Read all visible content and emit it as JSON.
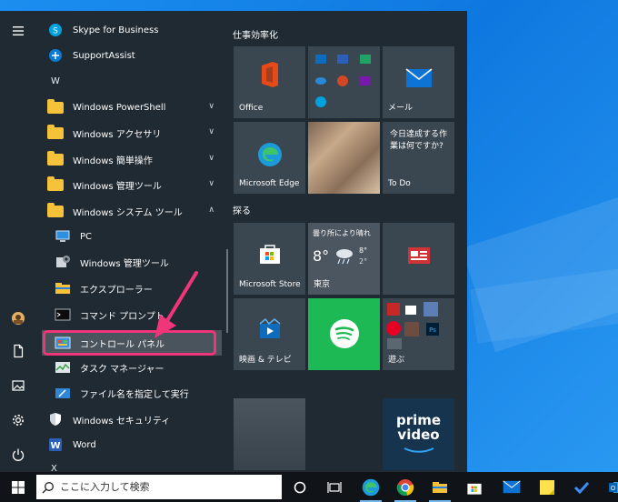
{
  "rail": {
    "menu_icon": "hamburger-icon",
    "bottom_icons": [
      "user-avatar",
      "documents-icon",
      "pictures-icon",
      "settings-icon",
      "power-icon"
    ]
  },
  "app_list": {
    "items": [
      {
        "label": "Skype for Business"
      },
      {
        "label": "SupportAssist"
      },
      {
        "letter": "W"
      },
      {
        "label": "Windows PowerShell"
      },
      {
        "label": "Windows アクセサリ"
      },
      {
        "label": "Windows 簡単操作"
      },
      {
        "label": "Windows 管理ツール"
      },
      {
        "label": "Windows システム ツール"
      },
      {
        "label": "PC"
      },
      {
        "label": "Windows 管理ツール"
      },
      {
        "label": "エクスプローラー"
      },
      {
        "label": "コマンド プロンプト"
      },
      {
        "label": "コントロール パネル"
      },
      {
        "label": "タスク マネージャー"
      },
      {
        "label": "ファイル名を指定して実行"
      },
      {
        "label": "Windows セキュリティ"
      },
      {
        "label": "Word"
      },
      {
        "letter": "X"
      }
    ]
  },
  "tiles": {
    "group1_title": "仕事効率化",
    "group2_title": "探る",
    "office": "Office",
    "mail": "メール",
    "edge": "Microsoft Edge",
    "todo_text": "今日達成する作業は何ですか?",
    "todo": "To Do",
    "weather_title": "曇り所により晴れ",
    "weather_temp": "8°",
    "weather_high": "8°",
    "weather_low": "2°",
    "weather_city": "東京",
    "store": "Microsoft Store",
    "movies": "映画 & テレビ",
    "play": "遊ぶ",
    "prime1": "prime",
    "prime2": "video"
  },
  "taskbar": {
    "search_placeholder": "ここに入力して検索"
  },
  "colors": {
    "accent_highlight": "#f0357a",
    "spotify": "#1db954",
    "mail": "#0d74d6"
  }
}
